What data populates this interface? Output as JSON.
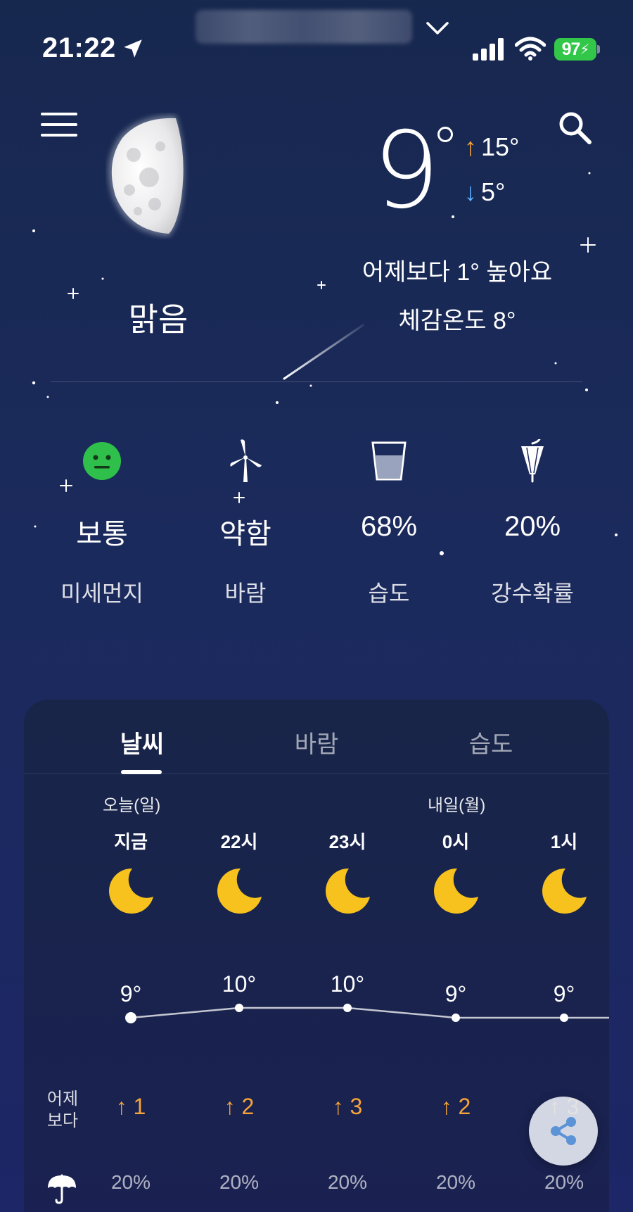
{
  "status_bar": {
    "time": "21:22",
    "battery": "97"
  },
  "current": {
    "temp": "9",
    "high": "15°",
    "low": "5°",
    "compare": "어제보다 1° 높아요",
    "feels_like": "체감온도 8°",
    "condition": "맑음"
  },
  "metrics": [
    {
      "value": "보통",
      "label": "미세먼지",
      "icon": "neutral-face-icon",
      "color": "#2ec04a"
    },
    {
      "value": "약함",
      "label": "바람",
      "icon": "wind-turbine-icon"
    },
    {
      "value": "68%",
      "label": "습도",
      "icon": "water-glass-icon"
    },
    {
      "value": "20%",
      "label": "강수확률",
      "icon": "umbrella-closed-icon"
    }
  ],
  "tabs": [
    {
      "label": "날씨",
      "active": true
    },
    {
      "label": "바람",
      "active": false
    },
    {
      "label": "습도",
      "active": false
    }
  ],
  "forecast": {
    "day_today": "오늘(일)",
    "day_tomorrow": "내일(월)",
    "yesterday_label_1": "어제",
    "yesterday_label_2": "보다",
    "hours": [
      {
        "time": "지금",
        "temp": "9°",
        "diff": "1",
        "rain": "20%"
      },
      {
        "time": "22시",
        "temp": "10°",
        "diff": "2",
        "rain": "20%"
      },
      {
        "time": "23시",
        "temp": "10°",
        "diff": "3",
        "rain": "20%"
      },
      {
        "time": "0시",
        "temp": "9°",
        "diff": "2",
        "rain": "20%"
      },
      {
        "time": "1시",
        "temp": "9°",
        "diff": "3",
        "rain": "20%"
      }
    ]
  },
  "colors": {
    "accent_up": "#f6a43a",
    "accent_down": "#5ab3ff",
    "moon_yellow": "#f7c21e"
  }
}
